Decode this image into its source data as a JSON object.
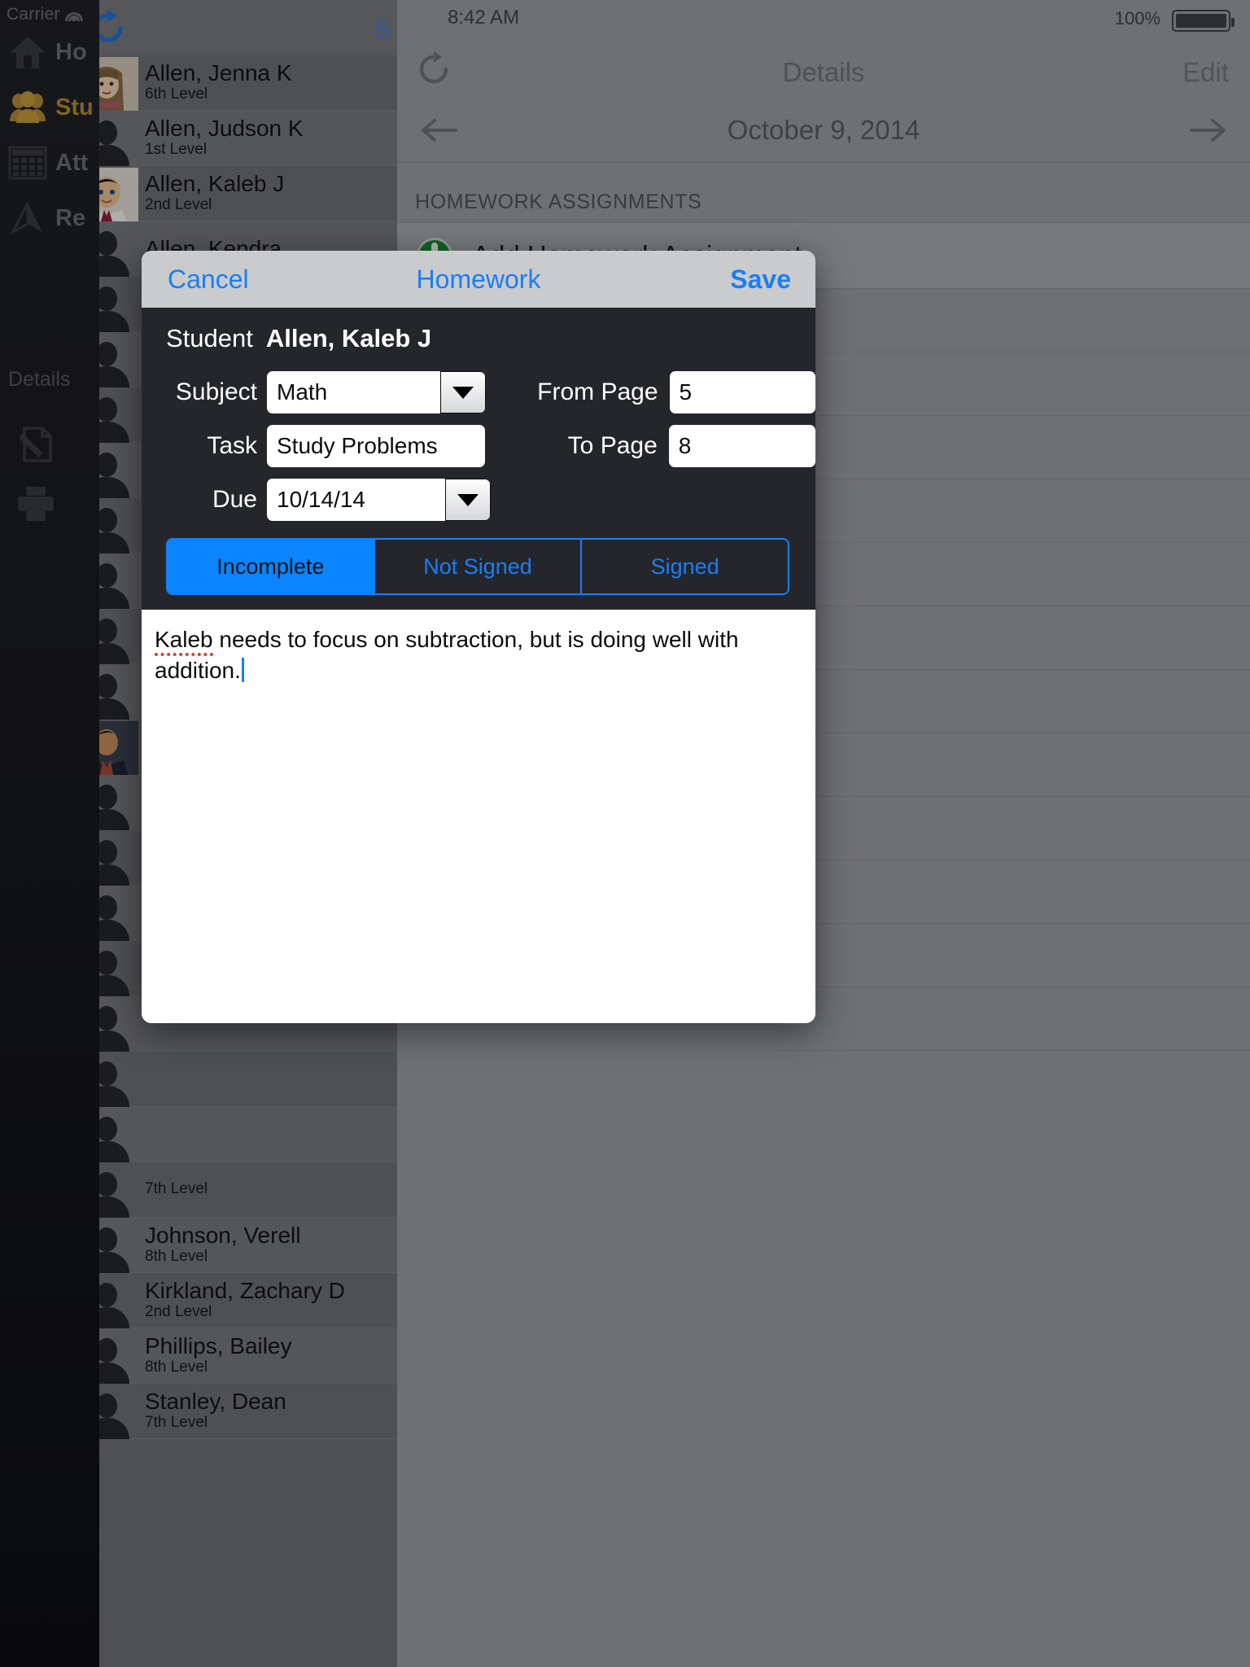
{
  "sidebar": {
    "status": {
      "carrier": "Carrier"
    },
    "items": [
      {
        "label": "Ho",
        "icon": "home-icon",
        "active": false
      },
      {
        "label": "Stu",
        "icon": "users-icon",
        "active": true
      },
      {
        "label": "Att",
        "icon": "calendar-grid-icon",
        "active": false
      },
      {
        "label": "Re",
        "icon": "report-icon",
        "active": false
      }
    ],
    "details_label": "Details",
    "sub_items": [
      {
        "label": "",
        "icon": "note-edit-icon"
      },
      {
        "label": "",
        "icon": "print-icon"
      }
    ]
  },
  "student_list": {
    "toolbar": {
      "refresh_icon": "refresh-icon",
      "search_label": "S"
    },
    "rows": [
      {
        "name": "Allen, Jenna K",
        "level": "6th Level",
        "avatar": "photo-girl"
      },
      {
        "name": "Allen, Judson K",
        "level": "1st Level",
        "avatar": "silhouette"
      },
      {
        "name": "Allen, Kaleb J",
        "level": "2nd Level",
        "avatar": "photo-boy"
      },
      {
        "name": "Allen, Kendra",
        "level": "",
        "avatar": "silhouette"
      },
      {
        "name": "",
        "level": "",
        "avatar": "silhouette"
      },
      {
        "name": "",
        "level": "",
        "avatar": "silhouette"
      },
      {
        "name": "",
        "level": "",
        "avatar": "silhouette"
      },
      {
        "name": "",
        "level": "",
        "avatar": "silhouette"
      },
      {
        "name": "",
        "level": "",
        "avatar": "silhouette"
      },
      {
        "name": "",
        "level": "",
        "avatar": "silhouette"
      },
      {
        "name": "",
        "level": "",
        "avatar": "silhouette"
      },
      {
        "name": "",
        "level": "",
        "avatar": "silhouette"
      },
      {
        "name": "",
        "level": "",
        "avatar": "photo-man"
      },
      {
        "name": "",
        "level": "",
        "avatar": "silhouette"
      },
      {
        "name": "",
        "level": "",
        "avatar": "silhouette"
      },
      {
        "name": "",
        "level": "",
        "avatar": "silhouette"
      },
      {
        "name": "",
        "level": "",
        "avatar": "silhouette"
      },
      {
        "name": "",
        "level": "",
        "avatar": "silhouette"
      },
      {
        "name": "",
        "level": "",
        "avatar": "silhouette"
      },
      {
        "name": "",
        "level": "",
        "avatar": "silhouette"
      },
      {
        "name": "",
        "level": "7th Level",
        "avatar": "silhouette"
      },
      {
        "name": "Johnson, Verell",
        "level": "8th Level",
        "avatar": "silhouette"
      },
      {
        "name": "Kirkland, Zachary D",
        "level": "2nd Level",
        "avatar": "silhouette"
      },
      {
        "name": "Phillips, Bailey",
        "level": "8th Level",
        "avatar": "silhouette"
      },
      {
        "name": "Stanley, Dean",
        "level": "7th Level",
        "avatar": "silhouette"
      }
    ]
  },
  "details": {
    "status": {
      "time": "8:42 AM",
      "battery": "100%"
    },
    "navbar": {
      "refresh_icon": "refresh-icon",
      "title": "Details",
      "edit_label": "Edit"
    },
    "datebar": {
      "prev_icon": "arrow-left-icon",
      "date": "October 9, 2014",
      "next_icon": "arrow-right-icon"
    },
    "section_header": "HOMEWORK ASSIGNMENTS",
    "add_row": {
      "icon": "plus-circle-icon",
      "label": "Add Homework Assignment"
    }
  },
  "modal": {
    "header": {
      "cancel": "Cancel",
      "title": "Homework",
      "save": "Save"
    },
    "student": {
      "label": "Student",
      "value": "Allen, Kaleb J"
    },
    "fields": {
      "subject": {
        "label": "Subject",
        "value": "Math",
        "type": "dropdown"
      },
      "task": {
        "label": "Task",
        "value": "Study Problems",
        "type": "text"
      },
      "due": {
        "label": "Due",
        "value": "10/14/14",
        "type": "dropdown"
      },
      "from_page": {
        "label": "From Page",
        "value": "5",
        "type": "text"
      },
      "to_page": {
        "label": "To Page",
        "value": "8",
        "type": "text"
      }
    },
    "status_segments": [
      {
        "label": "Incomplete",
        "selected": true
      },
      {
        "label": "Not Signed",
        "selected": false
      },
      {
        "label": "Signed",
        "selected": false
      }
    ],
    "notes": {
      "misspelled_word": "Kaleb",
      "rest": " needs to focus on subtraction, but is doing well with addition."
    }
  },
  "colors": {
    "accent_blue": "#1a7ef6",
    "selected_segment": "#0a84ff",
    "sidebar_active": "#b08a35",
    "modal_dark": "#24262b"
  }
}
